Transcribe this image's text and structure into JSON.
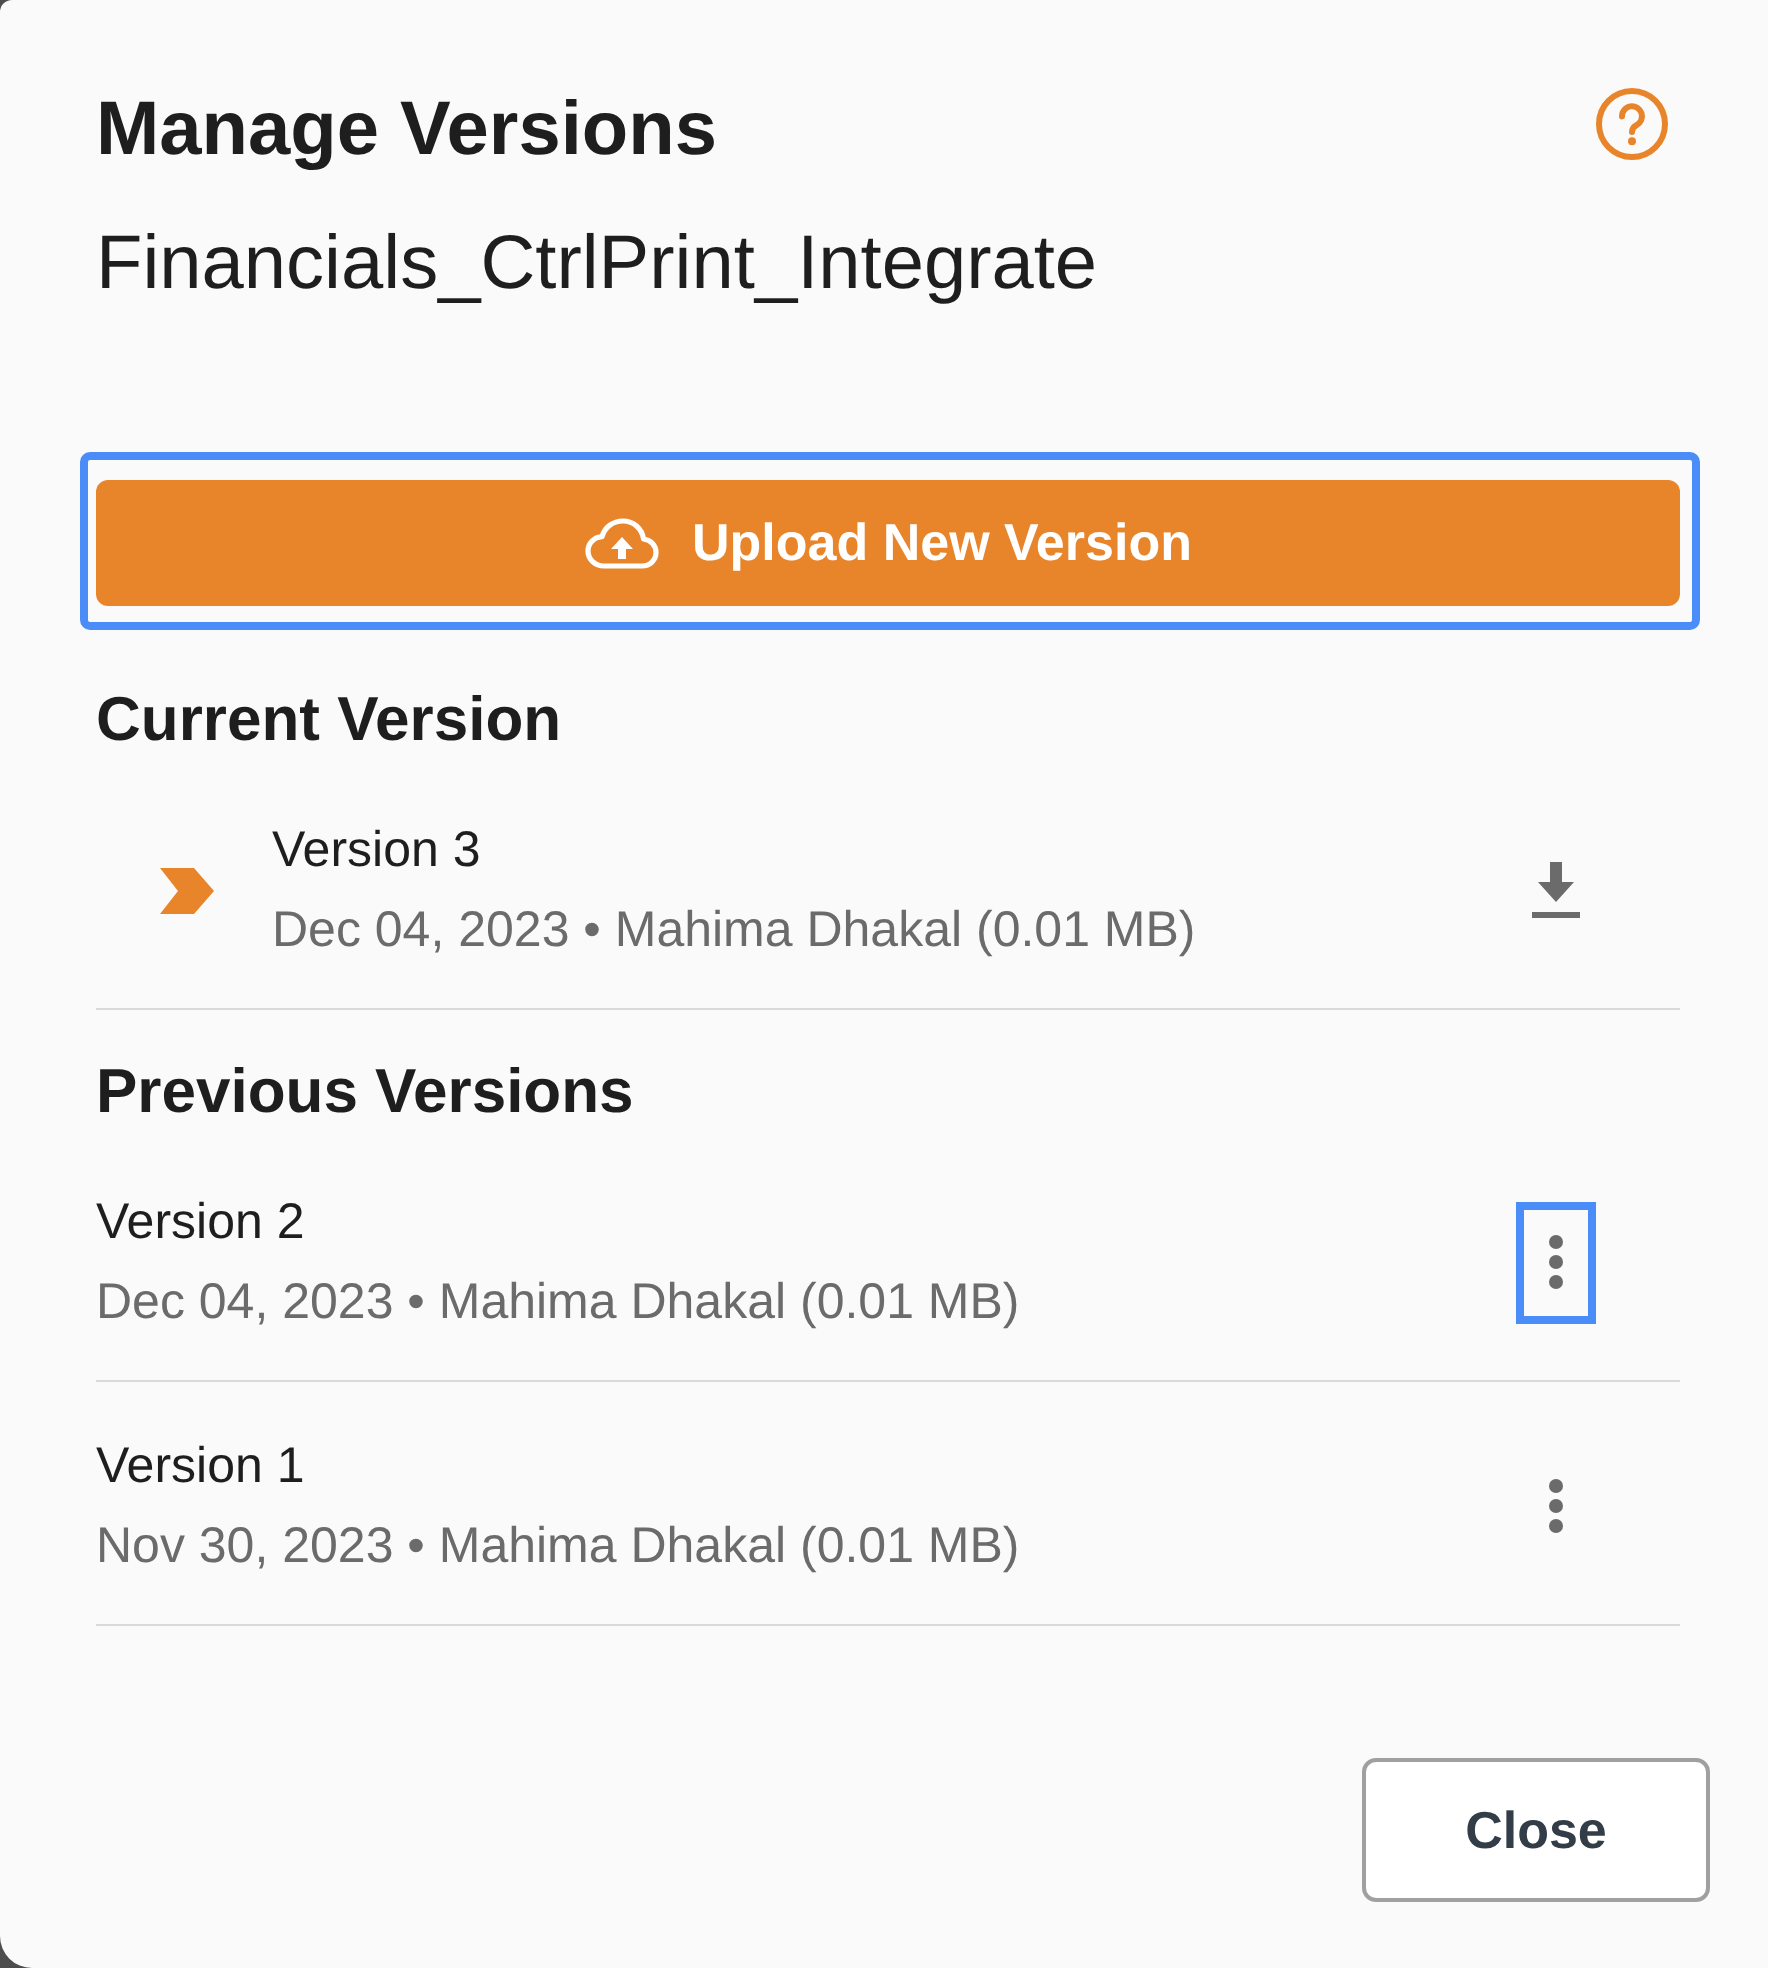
{
  "dialog": {
    "title": "Manage Versions",
    "subtitle": "Financials_CtrlPrint_Integrate",
    "upload_button": {
      "label": "Upload New Version",
      "focused": true
    },
    "current_version": {
      "heading": "Current Version",
      "version": {
        "name": "Version 3",
        "details": "Dec 04, 2023 • Mahima Dhakal (0.01 MB)"
      }
    },
    "previous_versions": {
      "heading": "Previous Versions",
      "versions": [
        {
          "name": "Version 2",
          "details": "Dec 04, 2023 • Mahima Dhakal (0.01 MB)",
          "focused": true
        },
        {
          "name": "Version 1",
          "details": "Nov 30, 2023 • Mahima Dhakal (0.01 MB)",
          "focused": false
        }
      ]
    },
    "close_button": {
      "label": "Close"
    }
  }
}
